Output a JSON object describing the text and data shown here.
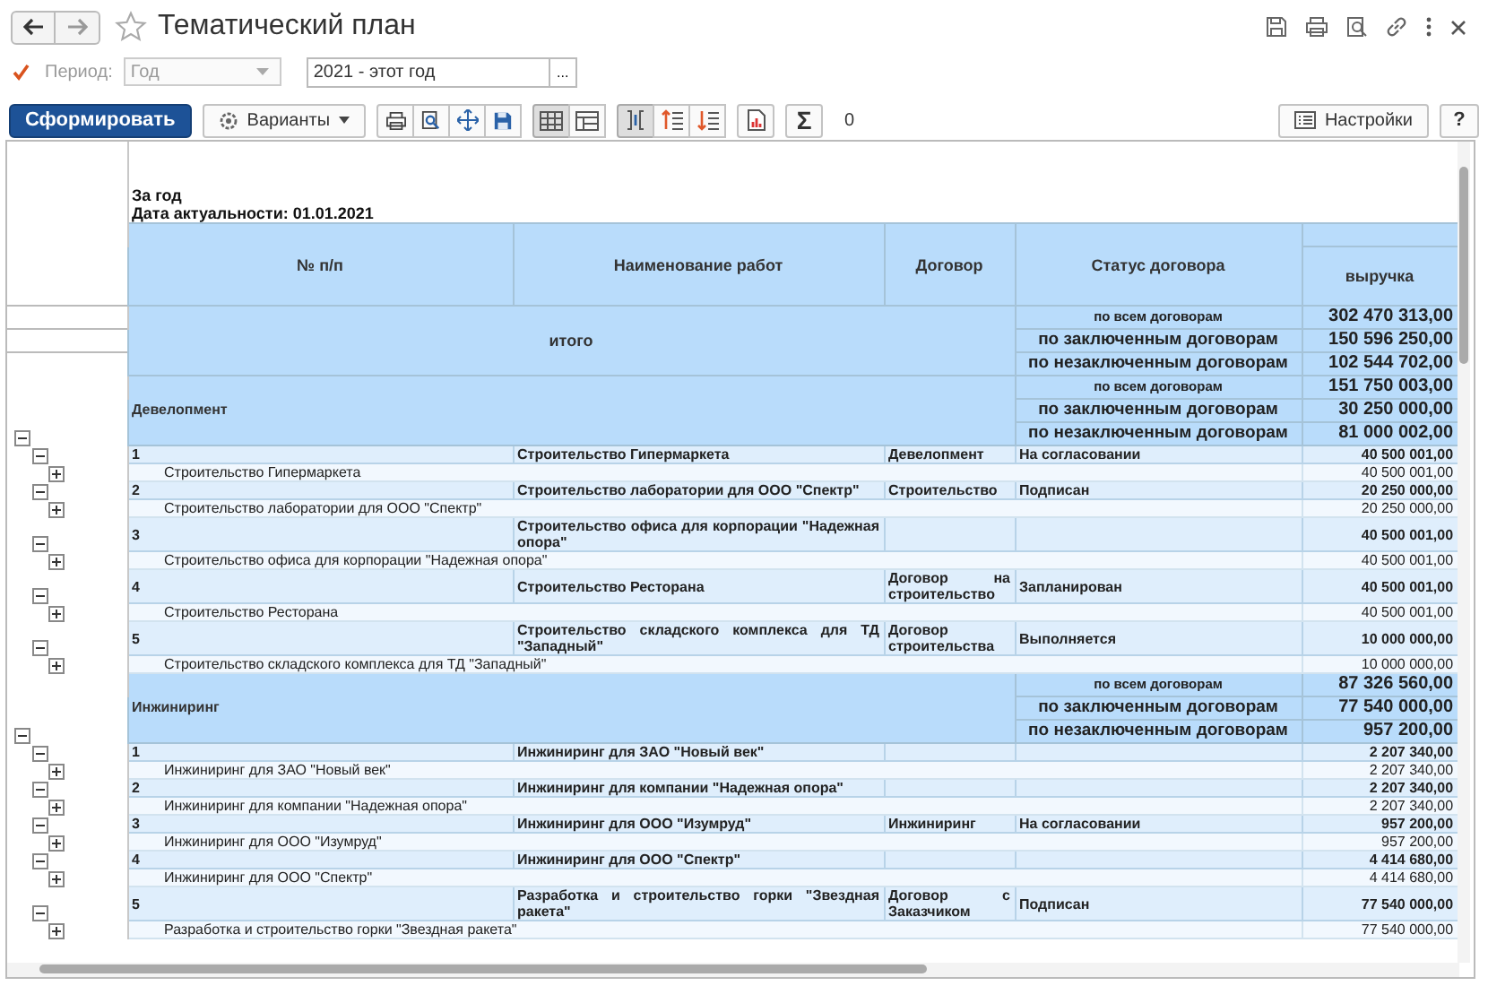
{
  "window": {
    "title": "Тематический план",
    "favorite": false
  },
  "period": {
    "enabled": true,
    "label": "Период:",
    "kind_field": {
      "value": "Год",
      "disabled": true
    },
    "value": "2021 - этот год",
    "choose_button": "..."
  },
  "toolbar": {
    "generate_button": "Сформировать",
    "variants_button": "Варианты",
    "view_modes": [
      {
        "selected": true
      },
      {
        "selected": false
      }
    ],
    "groupings": [
      {
        "selected": true
      },
      {
        "selected": false
      },
      {
        "selected": false
      }
    ],
    "sum_symbol": "Σ",
    "sum_value": "0",
    "settings_button": "Настройки",
    "help_button": "?"
  },
  "report": {
    "period_heading": "За  год",
    "date_line": "Дата актуальности: 01.01.2021",
    "columns": [
      "№ п/п",
      "Наименование работ",
      "Договор",
      "Статус договора"
    ],
    "value_column": "выручка",
    "total": {
      "label": "итого",
      "totals": [
        {
          "label": "по всем договорам",
          "value": "302 470 313,00"
        },
        {
          "label": "по заключенным договорам",
          "value": "150 596 250,00"
        },
        {
          "label": "по незаключенным договорам",
          "value": "102 544 702,00"
        }
      ]
    },
    "groups": [
      {
        "name": "Девелопмент",
        "expanded": true,
        "totals": [
          {
            "label": "по всем договорам",
            "value": "151 750 003,00"
          },
          {
            "label": "по заключенным договорам",
            "value": "30 250 000,00"
          },
          {
            "label": "по незаключенным договорам",
            "value": "81 000 002,00"
          }
        ],
        "items": [
          {
            "num": "1",
            "name": "Строительство Гипермаркета",
            "contract": "Девелопмент",
            "status": "На согласовании",
            "value": "40 500 001,00",
            "expanded": true,
            "detail": {
              "name": "Строительство Гипермаркета",
              "value": "40 500 001,00",
              "expanded": false
            }
          },
          {
            "num": "2",
            "name": "Строительство лаборатории для ООО \"Спектр\"",
            "contract": "Строительство",
            "status": "Подписан",
            "value": "20 250 000,00",
            "expanded": true,
            "detail": {
              "name": "Строительство лаборатории для ООО \"Спектр\"",
              "value": "20 250 000,00",
              "expanded": false
            }
          },
          {
            "num": "3",
            "name": "Строительство офиса для корпорации \"Надежная опора\"",
            "value": "40 500 001,00",
            "expanded": true,
            "detail": {
              "name": "Строительство офиса для корпорации \"Надежная опора\"",
              "value": "40 500 001,00",
              "expanded": false
            }
          },
          {
            "num": "4",
            "name": "Строительство Ресторана",
            "contract": "Договор на строительство",
            "status": "Запланирован",
            "value": "40 500 001,00",
            "expanded": true,
            "detail": {
              "name": "Строительство Ресторана",
              "value": "40 500 001,00",
              "expanded": false
            }
          },
          {
            "num": "5",
            "name": "Строительство складского комплекса для ТД \"Западный\"",
            "contract": "Договор строительства",
            "status": "Выполняется",
            "value": "10 000 000,00",
            "expanded": true,
            "detail": {
              "name": "Строительство складского комплекса для ТД \"Западный\"",
              "value": "10 000 000,00",
              "expanded": false
            }
          }
        ]
      },
      {
        "name": "Инжиниринг",
        "expanded": true,
        "totals": [
          {
            "label": "по всем договорам",
            "value": "87 326 560,00"
          },
          {
            "label": "по заключенным договорам",
            "value": "77 540 000,00"
          },
          {
            "label": "по незаключенным договорам",
            "value": "957 200,00"
          }
        ],
        "items": [
          {
            "num": "1",
            "name": "Инжиниринг для ЗАО \"Новый век\"",
            "value": "2 207 340,00",
            "expanded": true,
            "detail": {
              "name": "Инжиниринг для ЗАО \"Новый век\"",
              "value": "2 207 340,00",
              "expanded": false
            }
          },
          {
            "num": "2",
            "name": "Инжиниринг для компании \"Надежная опора\"",
            "value": "2 207 340,00",
            "expanded": true,
            "detail": {
              "name": "Инжиниринг для компании \"Надежная опора\"",
              "value": "2 207 340,00",
              "expanded": false
            }
          },
          {
            "num": "3",
            "name": "Инжиниринг для ООО \"Изумруд\"",
            "contract": "Инжиниринг",
            "status": "На согласовании",
            "value": "957 200,00",
            "expanded": true,
            "detail": {
              "name": "Инжиниринг для ООО \"Изумруд\"",
              "value": "957 200,00",
              "expanded": false
            }
          },
          {
            "num": "4",
            "name": "Инжиниринг для ООО \"Спектр\"",
            "value": "4 414 680,00",
            "expanded": true,
            "detail": {
              "name": "Инжиниринг для ООО \"Спектр\"",
              "value": "4 414 680,00",
              "expanded": false
            }
          },
          {
            "num": "5",
            "name": "Разработка и строительство горки \"Звездная ракета\"",
            "contract": "Договор с Заказчиком",
            "status": "Подписан",
            "value": "77 540 000,00",
            "expanded": true,
            "detail": {
              "name": "Разработка и строительство горки \"Звездная ракета\"",
              "value": "77 540 000,00",
              "expanded": false
            }
          }
        ]
      }
    ]
  }
}
